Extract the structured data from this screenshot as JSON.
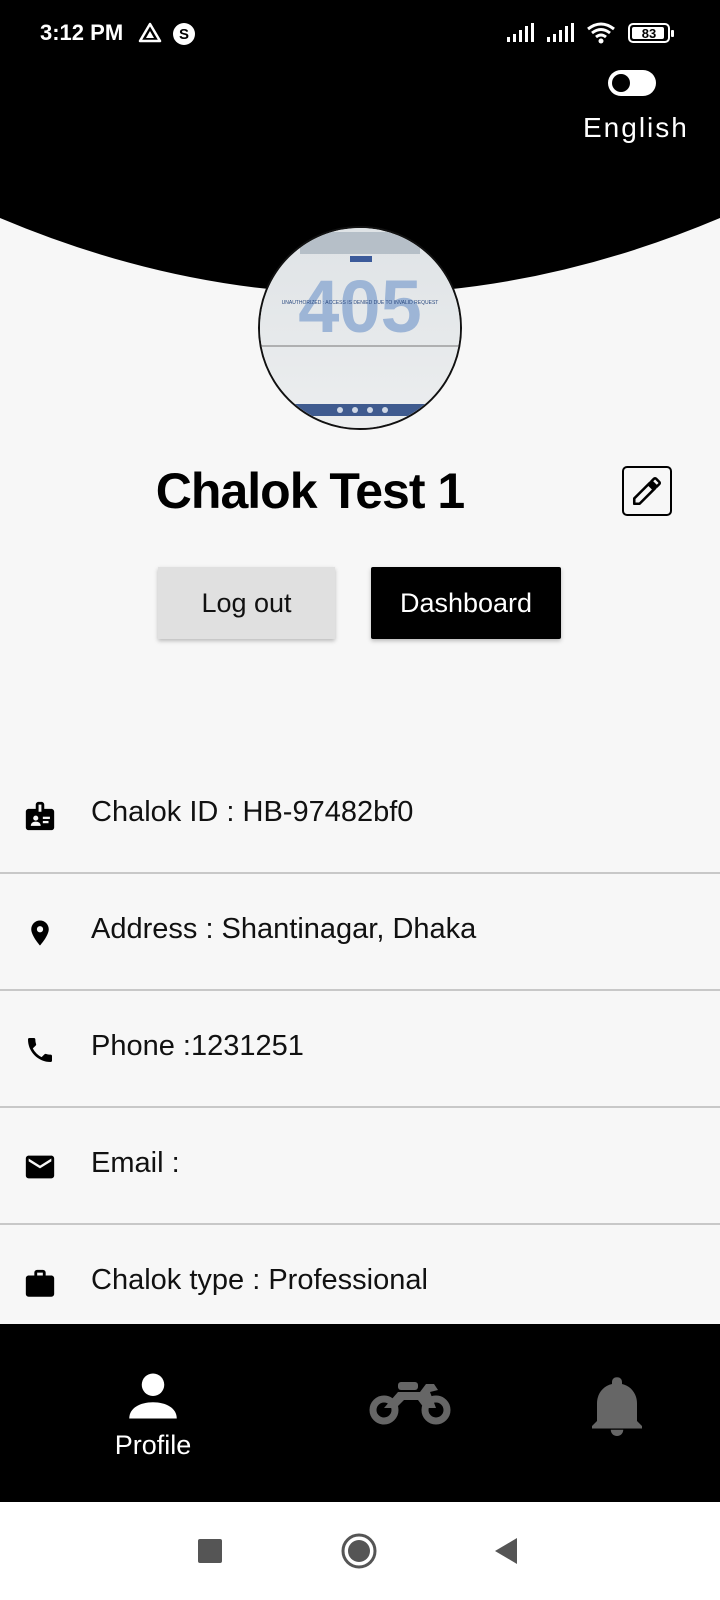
{
  "status_bar": {
    "time": "3:12 PM",
    "battery": "83",
    "icons": [
      "drive-icon",
      "s-app-icon",
      "signal-icon",
      "signal-icon",
      "wifi-icon",
      "battery-icon"
    ]
  },
  "language": {
    "label": "English",
    "toggle_on": false
  },
  "avatar": {
    "image_text": "405",
    "image_caption": "UNAUTHORIZED : ACCESS IS DENIED DUE TO INVALID REQUEST"
  },
  "profile": {
    "name": "Chalok Test 1"
  },
  "actions": {
    "logout_label": "Log out",
    "dashboard_label": "Dashboard"
  },
  "info_rows": [
    {
      "icon": "id-badge-icon",
      "text": "Chalok ID : HB-97482bf0"
    },
    {
      "icon": "location-pin-icon",
      "text": "Address : Shantinagar, Dhaka"
    },
    {
      "icon": "phone-icon",
      "text": "Phone :1231251"
    },
    {
      "icon": "email-icon",
      "text": "Email :"
    },
    {
      "icon": "briefcase-icon",
      "text": "Chalok type : Professional"
    }
  ],
  "bottom_nav": {
    "items": [
      {
        "icon": "person-icon",
        "label": "Profile",
        "active": true
      },
      {
        "icon": "motorcycle-icon",
        "active": false
      },
      {
        "icon": "bell-icon",
        "active": false
      }
    ]
  },
  "colors": {
    "background": "#f7f7f7",
    "header": "#000000",
    "inactive_icon": "#666666"
  }
}
